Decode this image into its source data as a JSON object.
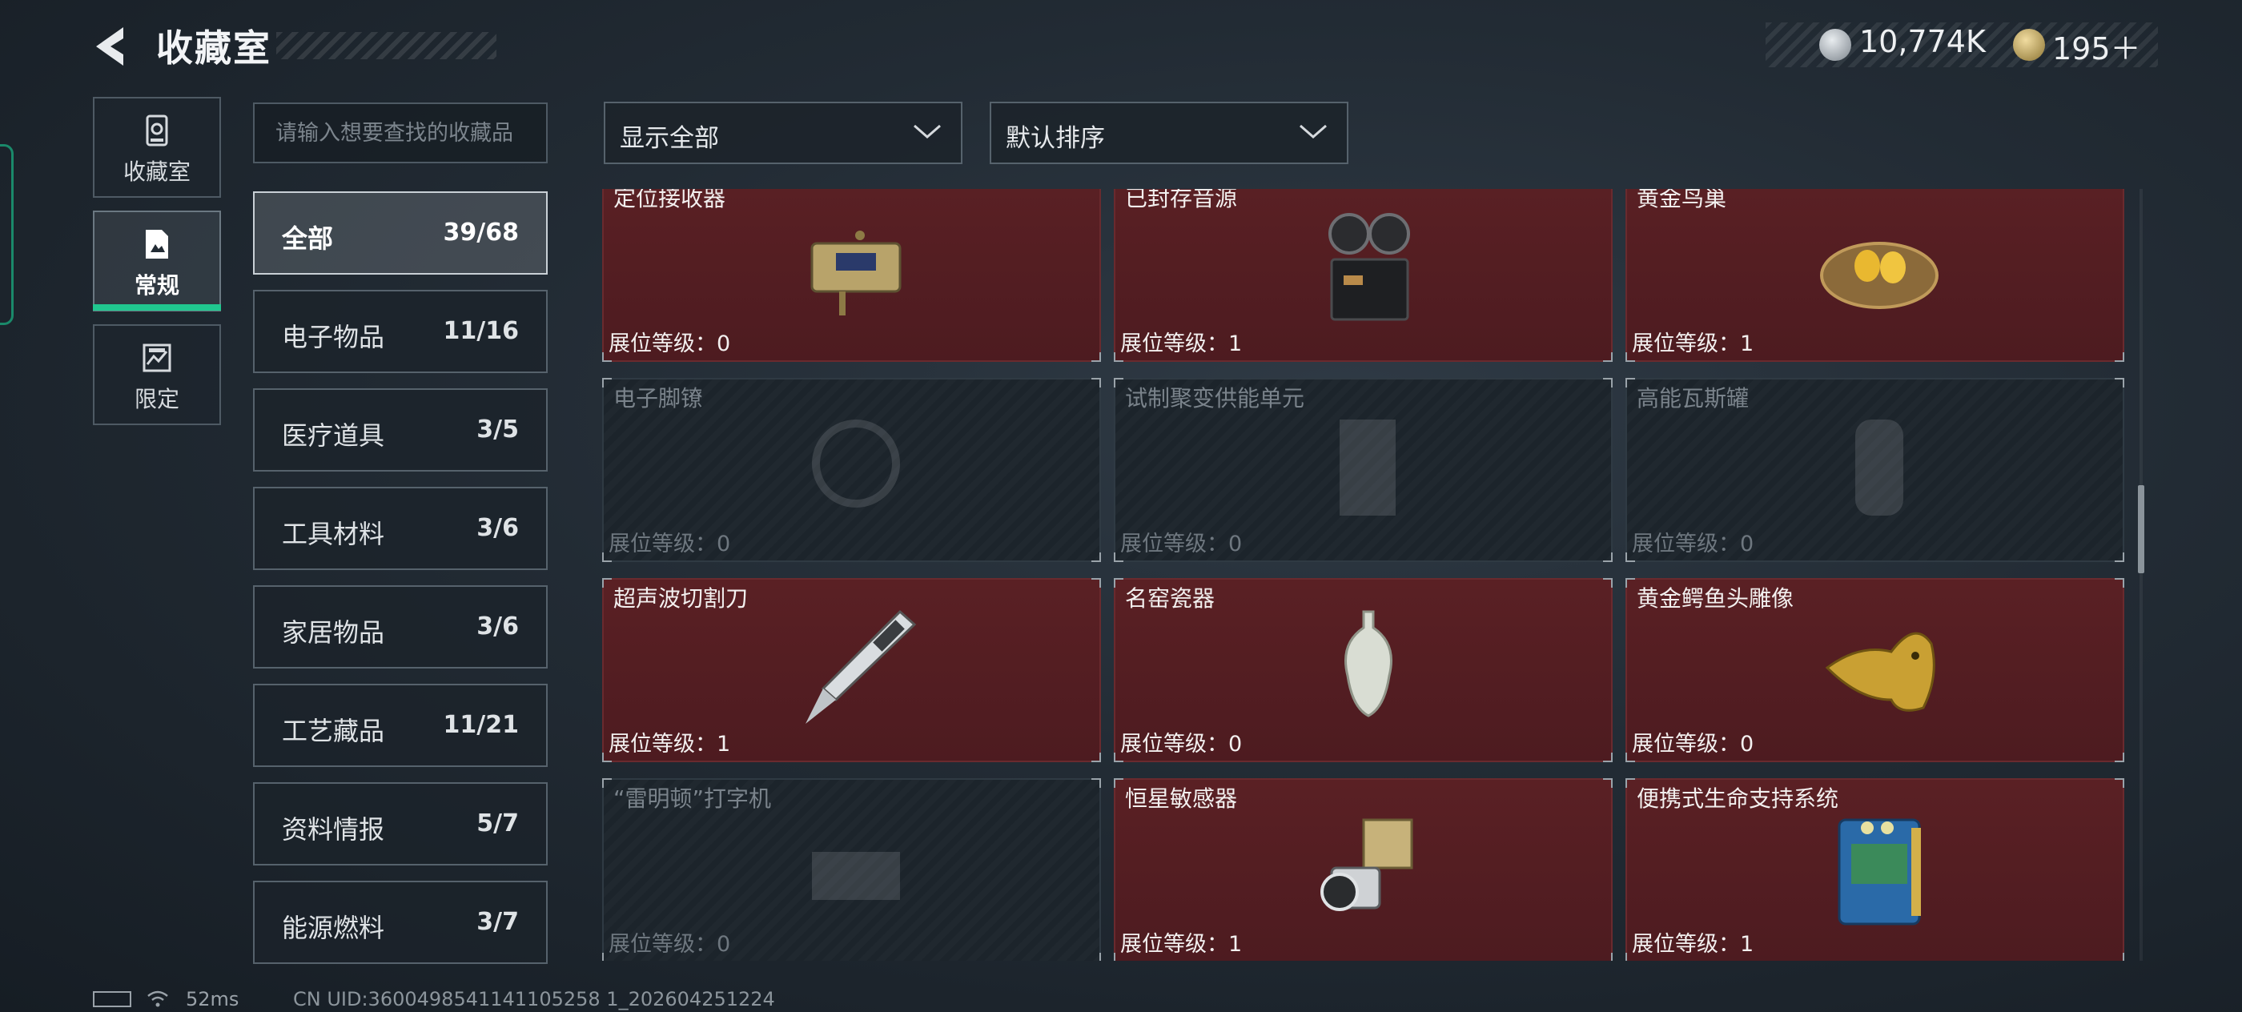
{
  "header": {
    "title": "收藏室",
    "currency_silver": "10,774K",
    "currency_gold": "195＋"
  },
  "side_tabs": [
    {
      "label": "收藏室",
      "icon": "collection-icon"
    },
    {
      "label": "常规",
      "icon": "regular-icon",
      "active": true
    },
    {
      "label": "限定",
      "icon": "limited-icon"
    }
  ],
  "search": {
    "placeholder": "请输入想要查找的收藏品",
    "value": ""
  },
  "filter": {
    "selected": "显示全部"
  },
  "sort": {
    "selected": "默认排序"
  },
  "categories": [
    {
      "name": "全部",
      "count": "39/68",
      "active": true
    },
    {
      "name": "电子物品",
      "count": "11/16"
    },
    {
      "name": "医疗道具",
      "count": "3/5"
    },
    {
      "name": "工具材料",
      "count": "3/6"
    },
    {
      "name": "家居物品",
      "count": "3/6"
    },
    {
      "name": "工艺藏品",
      "count": "11/21"
    },
    {
      "name": "资料情报",
      "count": "5/7"
    },
    {
      "name": "能源燃料",
      "count": "3/7"
    }
  ],
  "level_prefix": "展位等级：",
  "items": [
    {
      "name": "定位接收器",
      "level": "0",
      "owned": true,
      "icon": "receiver-icon"
    },
    {
      "name": "已封存音源",
      "level": "1",
      "owned": true,
      "icon": "tape-recorder-icon"
    },
    {
      "name": "黄金鸟巢",
      "level": "1",
      "owned": true,
      "icon": "golden-nest-icon"
    },
    {
      "name": "电子脚镣",
      "level": "0",
      "owned": false,
      "icon": "ankle-monitor-icon"
    },
    {
      "name": "试制聚变供能单元",
      "level": "0",
      "owned": false,
      "icon": "fusion-unit-icon"
    },
    {
      "name": "高能瓦斯罐",
      "level": "0",
      "owned": false,
      "icon": "gas-canister-icon"
    },
    {
      "name": "超声波切割刀",
      "level": "1",
      "owned": true,
      "icon": "ultrasonic-cutter-icon"
    },
    {
      "name": "名窑瓷器",
      "level": "0",
      "owned": true,
      "icon": "porcelain-vase-icon"
    },
    {
      "name": "黄金鳄鱼头雕像",
      "level": "0",
      "owned": true,
      "icon": "golden-crocodile-icon"
    },
    {
      "name": "“雷明顿”打字机",
      "level": "0",
      "owned": false,
      "icon": "typewriter-icon"
    },
    {
      "name": "恒星敏感器",
      "level": "1",
      "owned": true,
      "icon": "star-sensor-icon"
    },
    {
      "name": "便携式生命支持系统",
      "level": "1",
      "owned": true,
      "icon": "life-support-icon"
    }
  ],
  "footer": {
    "ping": "52ms",
    "uid": "CN UID:3600498541141105258 1_202604251224"
  }
}
